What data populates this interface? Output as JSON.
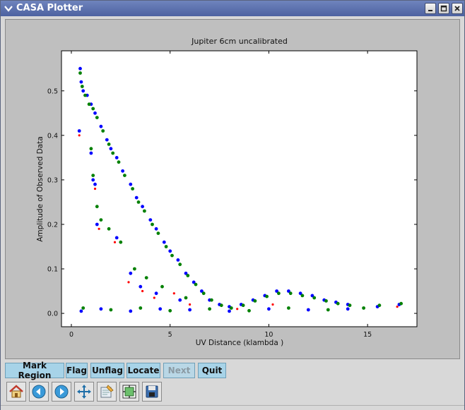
{
  "window": {
    "title": "CASA Plotter"
  },
  "toolbar": {
    "buttons": [
      {
        "label": "Mark Region",
        "enabled": true
      },
      {
        "label": "Flag",
        "enabled": true
      },
      {
        "label": "Unflag",
        "enabled": true
      },
      {
        "label": "Locate",
        "enabled": true
      },
      {
        "label": "Next",
        "enabled": false
      },
      {
        "label": "Quit",
        "enabled": true
      }
    ],
    "icons": [
      "home-icon",
      "back-icon",
      "forward-icon",
      "pan-icon",
      "zoom-icon",
      "subplots-icon",
      "save-icon"
    ]
  },
  "chart_data": {
    "type": "scatter",
    "title": "Jupiter 6cm uncalibrated",
    "xlabel": "UV Distance (klambda )",
    "ylabel": "Amplitude of Observed Data",
    "xlim": [
      -0.5,
      17.5
    ],
    "ylim": [
      -0.03,
      0.59
    ],
    "xticks": [
      "0",
      "5",
      "10",
      "15"
    ],
    "xtick_values": [
      0,
      5,
      10,
      15
    ],
    "yticks": [
      "0.0",
      "0.1",
      "0.2",
      "0.3",
      "0.4",
      "0.5"
    ],
    "ytick_values": [
      0.0,
      0.1,
      0.2,
      0.3,
      0.4,
      0.5
    ],
    "colors": {
      "blue": "#0000ff",
      "green": "#008000",
      "red": "#ff0000"
    },
    "series": [
      {
        "color": "#0000ff",
        "values": [
          [
            0.45,
            0.55
          ],
          [
            0.5,
            0.52
          ],
          [
            0.6,
            0.5
          ],
          [
            0.8,
            0.49
          ],
          [
            1.0,
            0.47
          ],
          [
            1.2,
            0.45
          ],
          [
            1.5,
            0.42
          ],
          [
            1.8,
            0.39
          ],
          [
            2.0,
            0.37
          ],
          [
            2.3,
            0.35
          ],
          [
            2.6,
            0.32
          ],
          [
            3.0,
            0.29
          ],
          [
            3.3,
            0.26
          ],
          [
            3.6,
            0.24
          ],
          [
            4.0,
            0.21
          ],
          [
            4.3,
            0.19
          ],
          [
            4.7,
            0.16
          ],
          [
            5.0,
            0.14
          ],
          [
            5.4,
            0.12
          ],
          [
            5.8,
            0.09
          ],
          [
            6.2,
            0.07
          ],
          [
            6.6,
            0.05
          ],
          [
            7.0,
            0.03
          ],
          [
            7.5,
            0.02
          ],
          [
            8.0,
            0.015
          ],
          [
            8.6,
            0.02
          ],
          [
            9.2,
            0.03
          ],
          [
            9.8,
            0.04
          ],
          [
            10.4,
            0.05
          ],
          [
            11.0,
            0.05
          ],
          [
            11.6,
            0.045
          ],
          [
            12.2,
            0.04
          ],
          [
            12.8,
            0.03
          ],
          [
            13.4,
            0.025
          ],
          [
            14.0,
            0.02
          ],
          [
            0.4,
            0.41
          ],
          [
            1.0,
            0.36
          ],
          [
            1.1,
            0.3
          ],
          [
            1.2,
            0.29
          ],
          [
            1.3,
            0.2
          ],
          [
            2.3,
            0.17
          ],
          [
            3.0,
            0.09
          ],
          [
            3.5,
            0.06
          ],
          [
            4.3,
            0.045
          ],
          [
            5.5,
            0.03
          ],
          [
            0.5,
            0.005
          ],
          [
            1.5,
            0.01
          ],
          [
            3.0,
            0.005
          ],
          [
            4.5,
            0.01
          ],
          [
            6.0,
            0.008
          ],
          [
            8.0,
            0.005
          ],
          [
            10.0,
            0.01
          ],
          [
            12.0,
            0.008
          ],
          [
            14.0,
            0.01
          ],
          [
            15.5,
            0.015
          ],
          [
            16.6,
            0.02
          ]
        ]
      },
      {
        "color": "#008000",
        "values": [
          [
            0.45,
            0.54
          ],
          [
            0.55,
            0.51
          ],
          [
            0.7,
            0.49
          ],
          [
            0.9,
            0.47
          ],
          [
            1.1,
            0.46
          ],
          [
            1.3,
            0.44
          ],
          [
            1.6,
            0.41
          ],
          [
            1.9,
            0.38
          ],
          [
            2.1,
            0.36
          ],
          [
            2.4,
            0.34
          ],
          [
            2.7,
            0.31
          ],
          [
            3.1,
            0.28
          ],
          [
            3.4,
            0.25
          ],
          [
            3.7,
            0.23
          ],
          [
            4.1,
            0.2
          ],
          [
            4.4,
            0.18
          ],
          [
            4.8,
            0.15
          ],
          [
            5.1,
            0.13
          ],
          [
            5.5,
            0.11
          ],
          [
            5.9,
            0.085
          ],
          [
            6.3,
            0.065
          ],
          [
            6.7,
            0.045
          ],
          [
            7.1,
            0.03
          ],
          [
            7.6,
            0.018
          ],
          [
            8.1,
            0.012
          ],
          [
            8.7,
            0.018
          ],
          [
            9.3,
            0.028
          ],
          [
            9.9,
            0.038
          ],
          [
            10.5,
            0.045
          ],
          [
            11.1,
            0.045
          ],
          [
            11.7,
            0.04
          ],
          [
            12.3,
            0.035
          ],
          [
            12.9,
            0.028
          ],
          [
            13.5,
            0.022
          ],
          [
            14.1,
            0.018
          ],
          [
            1.0,
            0.37
          ],
          [
            1.1,
            0.31
          ],
          [
            1.3,
            0.24
          ],
          [
            1.5,
            0.21
          ],
          [
            1.9,
            0.19
          ],
          [
            2.5,
            0.16
          ],
          [
            3.2,
            0.1
          ],
          [
            3.8,
            0.08
          ],
          [
            4.6,
            0.06
          ],
          [
            5.8,
            0.035
          ],
          [
            0.6,
            0.012
          ],
          [
            2.0,
            0.008
          ],
          [
            3.5,
            0.012
          ],
          [
            5.0,
            0.006
          ],
          [
            7.0,
            0.01
          ],
          [
            9.0,
            0.006
          ],
          [
            11.0,
            0.012
          ],
          [
            13.0,
            0.008
          ],
          [
            14.8,
            0.012
          ],
          [
            15.6,
            0.018
          ],
          [
            16.7,
            0.022
          ]
        ]
      },
      {
        "color": "#ff0000",
        "values": [
          [
            0.4,
            0.4
          ],
          [
            1.2,
            0.28
          ],
          [
            1.4,
            0.19
          ],
          [
            2.2,
            0.16
          ],
          [
            2.9,
            0.07
          ],
          [
            3.6,
            0.05
          ],
          [
            4.2,
            0.035
          ],
          [
            5.2,
            0.045
          ],
          [
            6.0,
            0.02
          ],
          [
            8.4,
            0.01
          ],
          [
            10.2,
            0.02
          ],
          [
            16.5,
            0.015
          ]
        ]
      }
    ]
  }
}
